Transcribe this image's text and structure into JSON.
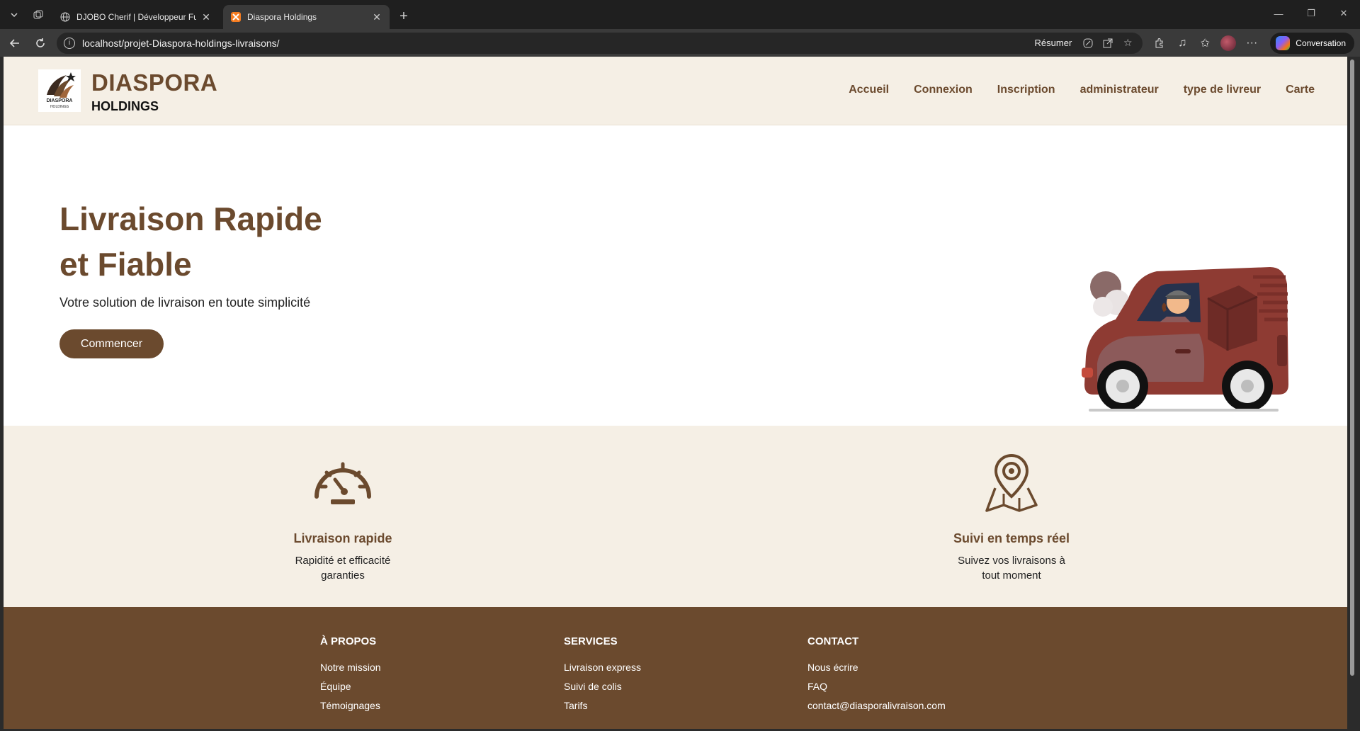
{
  "browser": {
    "tabs": [
      {
        "title": "DJOBO Cherif | Développeur Full S",
        "active": false
      },
      {
        "title": "Diaspora Holdings",
        "active": true
      }
    ],
    "url": "localhost/projet-Diaspora-holdings-livraisons/",
    "resume_label": "Résumer",
    "conversation_label": "Conversation"
  },
  "header": {
    "logo_text": "DIASPORA",
    "logo_subtext": "HOLDINGS",
    "brand_title": "DIASPORA",
    "brand_subtitle": "HOLDINGS",
    "nav": [
      "Accueil",
      "Connexion",
      "Inscription",
      "administrateur",
      "type de livreur",
      "Carte"
    ]
  },
  "hero": {
    "title_line1": "Livraison Rapide",
    "title_line2": "et Fiable",
    "subtitle": "Votre solution de livraison en toute simplicité",
    "cta_label": "Commencer"
  },
  "features": [
    {
      "icon": "speedometer-icon",
      "title": "Livraison rapide",
      "desc": "Rapidité et efficacité garanties"
    },
    {
      "icon": "map-pin-icon",
      "title": "Suivi en temps réel",
      "desc": "Suivez vos livraisons à tout moment"
    }
  ],
  "footer": {
    "columns": [
      {
        "title": "À PROPOS",
        "links": [
          "Notre mission",
          "Équipe",
          "Témoignages"
        ]
      },
      {
        "title": "SERVICES",
        "links": [
          "Livraison express",
          "Suivi de colis",
          "Tarifs"
        ]
      },
      {
        "title": "CONTACT",
        "links": [
          "Nous écrire",
          "FAQ",
          "contact@diasporalivraison.com"
        ]
      }
    ]
  },
  "colors": {
    "brand": "#6b4a2e",
    "cream": "#f5efe5",
    "van": "#8e3b33"
  }
}
